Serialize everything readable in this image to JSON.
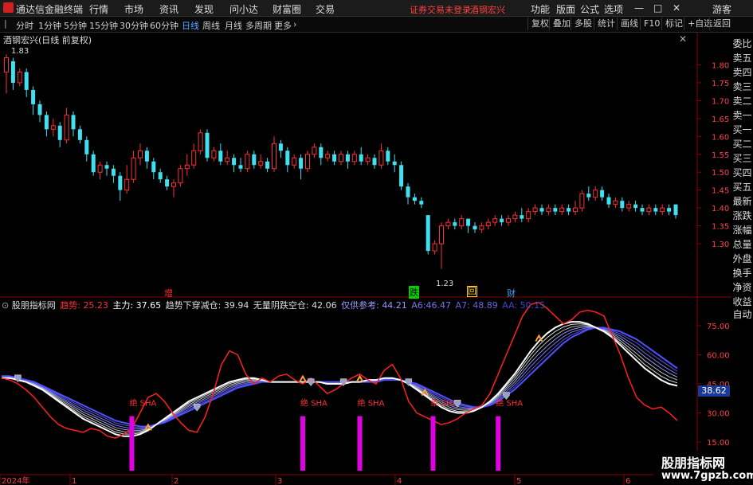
{
  "titlebar": {
    "app_name": "通达信金融终端",
    "menus": [
      "行情",
      "市场",
      "资讯",
      "发现",
      "问小达",
      "财富圈",
      "交易"
    ],
    "notice": "证券交易未登录",
    "stock_link": "酒钢宏兴",
    "right_menus": [
      "功能",
      "版面",
      "公式",
      "选项"
    ],
    "guest": "游客"
  },
  "toolbar": {
    "periods": [
      "分时",
      "1分钟",
      "5分钟",
      "15分钟",
      "30分钟",
      "60分钟",
      "日线",
      "周线",
      "月线",
      "多周期",
      "更多"
    ],
    "active_period": "日线",
    "right_buttons": [
      "复权",
      "叠加",
      "多股",
      "统计",
      "画线",
      "F10",
      "标记",
      "+自选",
      "返回"
    ]
  },
  "main_chart": {
    "title": "酒钢宏兴(日线 前复权)",
    "high_label": "1.83",
    "low_label": "1.23",
    "price_ticks": [
      "1.80",
      "1.75",
      "1.70",
      "1.65",
      "1.60",
      "1.55",
      "1.50",
      "1.45",
      "1.40",
      "1.35",
      "1.30"
    ],
    "markers": [
      {
        "text": "增",
        "color": "#ff3030"
      },
      {
        "text": "跌",
        "color": "#00e000"
      },
      {
        "text": "回",
        "color": "#ffd000"
      },
      {
        "text": "财",
        "color": "#40a0ff"
      }
    ]
  },
  "side_panel": {
    "items": [
      "委比",
      "卖五",
      "卖四",
      "卖三",
      "卖二",
      "卖一",
      "买一",
      "买二",
      "买三",
      "买四",
      "买五",
      "最新",
      "涨跌",
      "涨幅",
      "总量",
      "外盘",
      "换手",
      "净资",
      "收益"
    ],
    "auto_label": "自动"
  },
  "indicator": {
    "name": "股朋指标网",
    "legend": [
      {
        "label": "趋势:",
        "value": "25.23",
        "color": "#ff3030"
      },
      {
        "label": "主力:",
        "value": "37.65",
        "color": "#ffffff"
      },
      {
        "label": "趋势下穿减仓:",
        "value": "39.94",
        "color": "#dddddd"
      },
      {
        "label": "无量阴跌空仓:",
        "value": "42.06",
        "color": "#dddddd"
      },
      {
        "label": "仅供参考:",
        "value": "44.21",
        "color": "#8888ff"
      },
      {
        "label": "A6:",
        "value": "46.47",
        "color": "#6666ee"
      },
      {
        "label": "A7:",
        "value": "48.89",
        "color": "#5555dd"
      },
      {
        "label": "AA:",
        "value": "50.15",
        "color": "#3333cc"
      }
    ],
    "y_ticks": [
      "75.00",
      "60.00",
      "45.00",
      "30.00",
      "15.00"
    ],
    "current_value": "38.62",
    "sha_label": "绝 SHA"
  },
  "date_axis": {
    "labels": [
      "2024年",
      "1",
      "2",
      "3",
      "4",
      "5",
      "6"
    ]
  },
  "watermark": {
    "title": "股朋指标网",
    "url": "www.7gpzb.com"
  },
  "colors": {
    "up": "#ff3030",
    "down": "#40e0f0",
    "magenta": "#e000e0",
    "blue_line": "#5050ff",
    "accent_red_text": "#ff4040"
  },
  "chart_data": {
    "type": "candlestick",
    "y_range": [
      1.2,
      1.85
    ],
    "candles": [
      [
        1.78,
        1.82,
        1.72,
        1.83
      ],
      [
        1.81,
        1.75,
        1.73,
        1.82
      ],
      [
        1.75,
        1.78,
        1.74,
        1.79
      ],
      [
        1.78,
        1.73,
        1.71,
        1.79
      ],
      [
        1.73,
        1.69,
        1.66,
        1.74
      ],
      [
        1.69,
        1.66,
        1.64,
        1.7
      ],
      [
        1.66,
        1.62,
        1.6,
        1.67
      ],
      [
        1.62,
        1.63,
        1.6,
        1.65
      ],
      [
        1.63,
        1.59,
        1.57,
        1.64
      ],
      [
        1.59,
        1.66,
        1.58,
        1.68
      ],
      [
        1.66,
        1.62,
        1.6,
        1.67
      ],
      [
        1.62,
        1.59,
        1.58,
        1.63
      ],
      [
        1.59,
        1.55,
        1.53,
        1.6
      ],
      [
        1.55,
        1.5,
        1.49,
        1.56
      ],
      [
        1.5,
        1.52,
        1.48,
        1.53
      ],
      [
        1.52,
        1.51,
        1.49,
        1.53
      ],
      [
        1.51,
        1.49,
        1.47,
        1.52
      ],
      [
        1.49,
        1.45,
        1.42,
        1.5
      ],
      [
        1.45,
        1.48,
        1.44,
        1.52
      ],
      [
        1.48,
        1.54,
        1.47,
        1.56
      ],
      [
        1.54,
        1.56,
        1.52,
        1.58
      ],
      [
        1.56,
        1.53,
        1.51,
        1.57
      ],
      [
        1.53,
        1.5,
        1.48,
        1.54
      ],
      [
        1.5,
        1.48,
        1.47,
        1.51
      ],
      [
        1.48,
        1.46,
        1.45,
        1.49
      ],
      [
        1.46,
        1.47,
        1.43,
        1.48
      ],
      [
        1.47,
        1.51,
        1.46,
        1.52
      ],
      [
        1.51,
        1.52,
        1.49,
        1.55
      ],
      [
        1.52,
        1.56,
        1.51,
        1.58
      ],
      [
        1.56,
        1.61,
        1.55,
        1.62
      ],
      [
        1.61,
        1.54,
        1.53,
        1.62
      ],
      [
        1.54,
        1.56,
        1.53,
        1.57
      ],
      [
        1.56,
        1.53,
        1.52,
        1.58
      ],
      [
        1.53,
        1.54,
        1.52,
        1.56
      ],
      [
        1.54,
        1.52,
        1.5,
        1.55
      ],
      [
        1.52,
        1.51,
        1.5,
        1.54
      ],
      [
        1.51,
        1.55,
        1.5,
        1.56
      ],
      [
        1.55,
        1.52,
        1.51,
        1.56
      ],
      [
        1.52,
        1.53,
        1.51,
        1.55
      ],
      [
        1.53,
        1.51,
        1.5,
        1.54
      ],
      [
        1.51,
        1.58,
        1.5,
        1.6
      ],
      [
        1.58,
        1.56,
        1.54,
        1.59
      ],
      [
        1.56,
        1.52,
        1.5,
        1.57
      ],
      [
        1.52,
        1.54,
        1.51,
        1.55
      ],
      [
        1.54,
        1.51,
        1.48,
        1.55
      ],
      [
        1.51,
        1.55,
        1.5,
        1.56
      ],
      [
        1.55,
        1.57,
        1.54,
        1.58
      ],
      [
        1.57,
        1.54,
        1.52,
        1.58
      ],
      [
        1.54,
        1.55,
        1.53,
        1.56
      ],
      [
        1.55,
        1.53,
        1.52,
        1.56
      ],
      [
        1.53,
        1.55,
        1.52,
        1.56
      ],
      [
        1.55,
        1.53,
        1.51,
        1.56
      ],
      [
        1.53,
        1.55,
        1.52,
        1.56
      ],
      [
        1.55,
        1.53,
        1.52,
        1.57
      ],
      [
        1.53,
        1.54,
        1.52,
        1.55
      ],
      [
        1.54,
        1.52,
        1.51,
        1.55
      ],
      [
        1.52,
        1.56,
        1.51,
        1.58
      ],
      [
        1.56,
        1.53,
        1.52,
        1.57
      ],
      [
        1.53,
        1.52,
        1.5,
        1.55
      ],
      [
        1.52,
        1.46,
        1.45,
        1.53
      ],
      [
        1.46,
        1.43,
        1.41,
        1.47
      ],
      [
        1.43,
        1.42,
        1.41,
        1.44
      ],
      [
        1.42,
        1.41,
        1.4,
        1.43
      ],
      [
        1.38,
        1.28,
        1.27,
        1.38
      ],
      [
        1.28,
        1.3,
        1.27,
        1.31
      ],
      [
        1.3,
        1.35,
        1.23,
        1.36
      ],
      [
        1.35,
        1.36,
        1.34,
        1.37
      ],
      [
        1.36,
        1.35,
        1.34,
        1.37
      ],
      [
        1.35,
        1.37,
        1.34,
        1.38
      ],
      [
        1.37,
        1.35,
        1.33,
        1.37
      ],
      [
        1.35,
        1.34,
        1.33,
        1.36
      ],
      [
        1.34,
        1.35,
        1.33,
        1.36
      ],
      [
        1.35,
        1.36,
        1.34,
        1.37
      ],
      [
        1.36,
        1.37,
        1.35,
        1.38
      ],
      [
        1.37,
        1.36,
        1.35,
        1.38
      ],
      [
        1.36,
        1.37,
        1.35,
        1.38
      ],
      [
        1.37,
        1.38,
        1.36,
        1.39
      ],
      [
        1.38,
        1.37,
        1.36,
        1.4
      ],
      [
        1.37,
        1.39,
        1.36,
        1.4
      ],
      [
        1.39,
        1.4,
        1.38,
        1.41
      ],
      [
        1.4,
        1.39,
        1.38,
        1.41
      ],
      [
        1.39,
        1.4,
        1.38,
        1.41
      ],
      [
        1.4,
        1.39,
        1.38,
        1.41
      ],
      [
        1.39,
        1.4,
        1.38,
        1.41
      ],
      [
        1.4,
        1.39,
        1.38,
        1.41
      ],
      [
        1.39,
        1.4,
        1.38,
        1.42
      ],
      [
        1.4,
        1.44,
        1.39,
        1.45
      ],
      [
        1.44,
        1.43,
        1.42,
        1.46
      ],
      [
        1.43,
        1.45,
        1.42,
        1.46
      ],
      [
        1.45,
        1.43,
        1.42,
        1.46
      ],
      [
        1.43,
        1.41,
        1.4,
        1.44
      ],
      [
        1.41,
        1.42,
        1.4,
        1.43
      ],
      [
        1.42,
        1.4,
        1.39,
        1.43
      ],
      [
        1.4,
        1.41,
        1.39,
        1.42
      ],
      [
        1.41,
        1.4,
        1.39,
        1.42
      ],
      [
        1.4,
        1.39,
        1.38,
        1.41
      ],
      [
        1.39,
        1.4,
        1.38,
        1.41
      ],
      [
        1.4,
        1.39,
        1.38,
        1.41
      ],
      [
        1.39,
        1.4,
        1.38,
        1.41
      ],
      [
        1.4,
        1.39,
        1.38,
        1.41
      ],
      [
        1.41,
        1.38,
        1.37,
        1.41
      ]
    ],
    "indicator_trend": [
      48,
      47,
      45,
      42,
      38,
      33,
      28,
      24,
      22,
      21,
      20,
      22,
      21,
      18,
      17,
      19,
      22,
      30,
      38,
      40,
      36,
      30,
      25,
      21,
      20,
      28,
      40,
      55,
      62,
      60,
      50,
      45,
      48,
      46,
      49,
      50,
      47,
      45,
      48,
      44,
      40,
      42,
      45,
      48,
      50,
      47,
      45,
      52,
      55,
      48,
      36,
      30,
      28,
      26,
      24,
      25,
      27,
      30,
      32,
      34,
      40,
      50,
      60,
      70,
      80,
      86,
      87,
      84,
      80,
      76,
      78,
      82,
      83,
      82,
      80,
      70,
      60,
      48,
      38,
      34,
      32,
      33,
      30,
      26
    ],
    "indicator_main": [
      48,
      48,
      47,
      46,
      44,
      42,
      39,
      36,
      33,
      30,
      27,
      25,
      23,
      21,
      19,
      18,
      18,
      19,
      21,
      24,
      27,
      30,
      33,
      36,
      38,
      40,
      42,
      44,
      46,
      47,
      48,
      48,
      47,
      46,
      46,
      46,
      46,
      46,
      46,
      46,
      45,
      45,
      45,
      46,
      46,
      47,
      47,
      48,
      48,
      47,
      45,
      42,
      39,
      36,
      33,
      31,
      30,
      30,
      31,
      33,
      36,
      40,
      45,
      50,
      56,
      62,
      67,
      71,
      74,
      76,
      77,
      77,
      76,
      74,
      72,
      69,
      65,
      61,
      57,
      53,
      50,
      47,
      45,
      44
    ],
    "indicator_slow": [
      49,
      49,
      48,
      47,
      46,
      44,
      42,
      40,
      38,
      36,
      34,
      32,
      30,
      28,
      26,
      25,
      24,
      23,
      23,
      24,
      25,
      27,
      29,
      31,
      33,
      35,
      37,
      39,
      41,
      43,
      44,
      45,
      46,
      46,
      46,
      46,
      46,
      46,
      46,
      46,
      46,
      46,
      46,
      46,
      46,
      46,
      46,
      47,
      47,
      47,
      46,
      45,
      43,
      41,
      39,
      37,
      35,
      34,
      33,
      33,
      34,
      36,
      39,
      42,
      46,
      50,
      54,
      58,
      62,
      66,
      69,
      71,
      73,
      74,
      74,
      73,
      72,
      70,
      68,
      65,
      62,
      59,
      56,
      53
    ],
    "sha_signal_x": [
      16,
      37,
      44,
      53,
      61
    ],
    "buy_markers": [
      18,
      37,
      44,
      52,
      66
    ]
  }
}
